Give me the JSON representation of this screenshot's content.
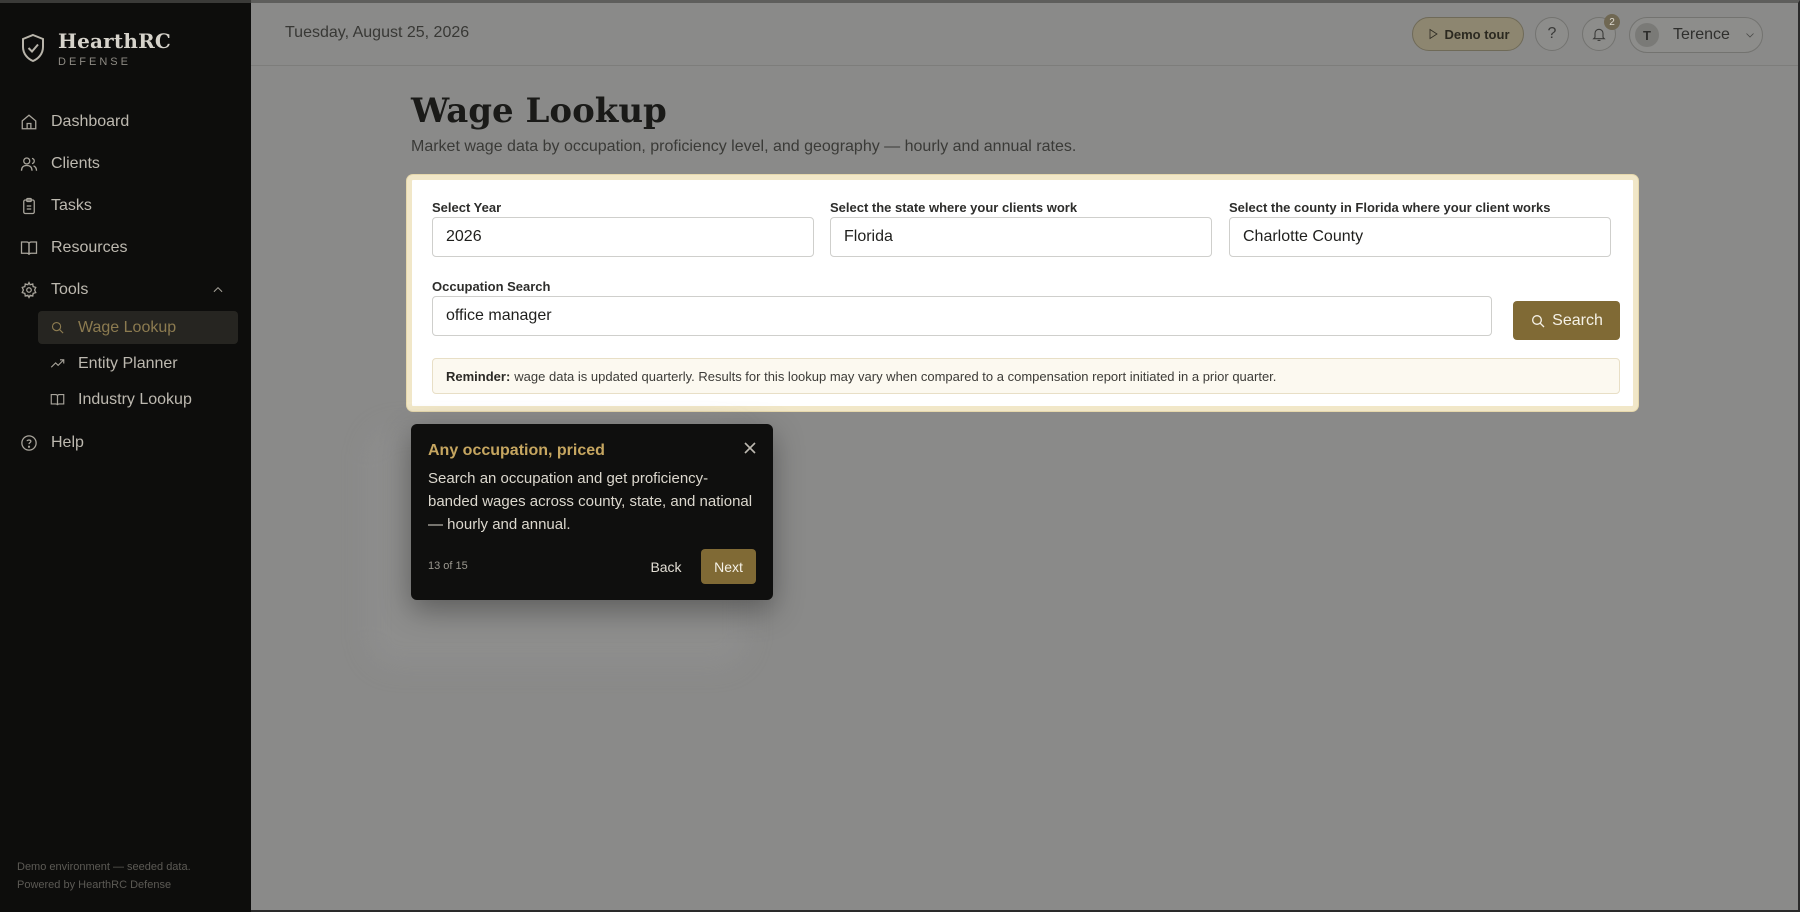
{
  "brand": {
    "name": "HearthRC",
    "sub": "DEFENSE"
  },
  "sidebar": {
    "items": [
      {
        "label": "Dashboard",
        "icon": "home-icon"
      },
      {
        "label": "Clients",
        "icon": "users-icon"
      },
      {
        "label": "Tasks",
        "icon": "clipboard-icon"
      },
      {
        "label": "Resources",
        "icon": "book-icon"
      },
      {
        "label": "Tools",
        "icon": "gear-icon",
        "expanded": true
      }
    ],
    "tools": [
      {
        "label": "Wage Lookup",
        "icon": "search-icon",
        "active": true
      },
      {
        "label": "Entity Planner",
        "icon": "trend-up-icon"
      },
      {
        "label": "Industry Lookup",
        "icon": "book-icon"
      }
    ],
    "help": {
      "label": "Help",
      "icon": "help-circle-icon"
    },
    "footer": {
      "line1": "Demo environment — seeded data.",
      "line2": "Powered by HearthRC Defense"
    }
  },
  "topbar": {
    "date": "Tuesday, August 25, 2026",
    "demo_tour": "Demo tour",
    "help_glyph": "?",
    "notifications_count": "2",
    "user": {
      "initial": "T",
      "name": "Terence"
    }
  },
  "page": {
    "title": "Wage Lookup",
    "subtitle": "Market wage data by occupation, proficiency level, and geography — hourly and annual rates."
  },
  "form": {
    "year_label": "Select Year",
    "year_value": "2026",
    "state_label": "Select the state where your clients work",
    "state_value": "Florida",
    "county_label": "Select the county in Florida where your client works",
    "county_value": "Charlotte County",
    "occupation_label": "Occupation Search",
    "occupation_value": "office manager",
    "search_label": "Search",
    "reminder_bold": "Reminder:",
    "reminder_text": "wage data is updated quarterly. Results for this lookup may vary when compared to a compensation report initiated in a prior quarter."
  },
  "tour": {
    "title": "Any occupation, priced",
    "body": "Search an occupation and get proficiency-banded wages across county, state, and national — hourly and annual.",
    "step": "13 of 15",
    "back": "Back",
    "next": "Next"
  },
  "colors": {
    "accent": "#806a35",
    "sidebar_bg": "#0d0d0c",
    "tour_title": "#c6a660"
  }
}
